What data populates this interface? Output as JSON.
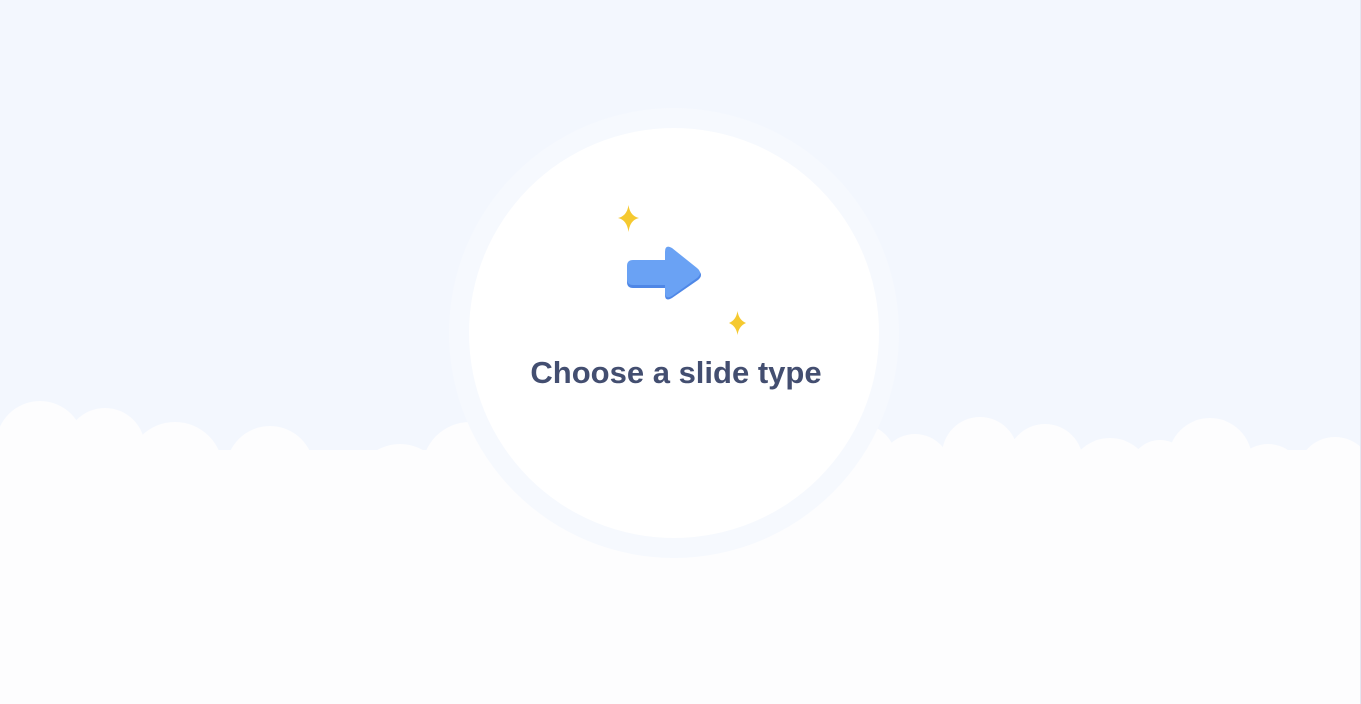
{
  "empty_state": {
    "title": "Choose a slide type",
    "illustration_icon": "arrow-right-icon",
    "decoration_icons": [
      "sparkle-icon",
      "sparkle-icon"
    ]
  },
  "colors": {
    "background": "#f3f7fe",
    "cloud": "#fdfdfe",
    "circle_ring": "#f6f9fe",
    "circle": "#ffffff",
    "title_text": "#434e70",
    "arrow": "#6aa2f4",
    "arrow_shadow": "#4f87e6",
    "sparkle": "#f5c930"
  }
}
